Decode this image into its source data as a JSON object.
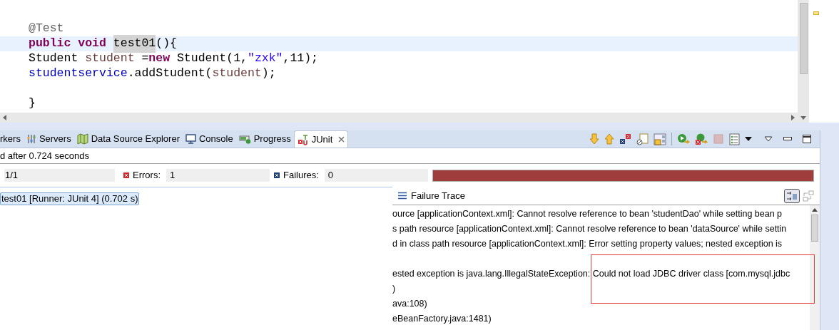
{
  "editor": {
    "lines": [
      {
        "kind": "code",
        "current": false,
        "tokens": [
          {
            "text": "@Test",
            "kind": "annotation"
          }
        ]
      },
      {
        "kind": "code",
        "current": true,
        "tokens": [
          {
            "text": "public ",
            "kind": "keyword"
          },
          {
            "text": "void ",
            "kind": "keyword"
          },
          {
            "text": "test01",
            "kind": "occurrence"
          },
          {
            "text": "(){",
            "kind": "plain"
          }
        ]
      },
      {
        "kind": "code",
        "current": false,
        "tokens": [
          {
            "text": "Student ",
            "kind": "plain"
          },
          {
            "text": "student",
            "kind": "local"
          },
          {
            "text": " =",
            "kind": "plain"
          },
          {
            "text": "new",
            "kind": "keyword"
          },
          {
            "text": " Student(1,",
            "kind": "plain"
          },
          {
            "text": "\"zxk\"",
            "kind": "string"
          },
          {
            "text": ",11);",
            "kind": "plain"
          }
        ]
      },
      {
        "kind": "code",
        "current": false,
        "tokens": [
          {
            "text": "studentservice",
            "kind": "field"
          },
          {
            "text": ".addStudent(",
            "kind": "plain"
          },
          {
            "text": "student",
            "kind": "local"
          },
          {
            "text": ");",
            "kind": "plain"
          }
        ]
      },
      {
        "kind": "blank",
        "current": false
      },
      {
        "kind": "code",
        "current": false,
        "tokens": [
          {
            "text": "}",
            "kind": "plain"
          }
        ]
      }
    ]
  },
  "tabs": [
    {
      "label": "rkers",
      "kind": "markers",
      "selected": false
    },
    {
      "label": "Servers",
      "kind": "servers",
      "selected": false
    },
    {
      "label": "Data Source Explorer",
      "kind": "datasource",
      "selected": false
    },
    {
      "label": "Console",
      "kind": "console",
      "selected": false
    },
    {
      "label": "Progress",
      "kind": "progress",
      "selected": false
    },
    {
      "label": "JUnit",
      "kind": "junit",
      "selected": true
    }
  ],
  "status": "d after 0.724 seconds",
  "counters": {
    "runs": "1/1",
    "errors_label": "Errors:",
    "errors": "1",
    "failures_label": "Failures:",
    "failures": "0"
  },
  "progress": {
    "level": 1,
    "failed": true
  },
  "tests": [
    {
      "label": "test01 [Runner: JUnit 4] (0.702 s)",
      "selected": true
    }
  ],
  "failure_trace": {
    "title": "Failure Trace",
    "blocks": [
      [
        "ource [applicationContext.xml]: Cannot resolve reference to bean 'studentDao' while setting bean p",
        "s path resource [applicationContext.xml]: Cannot resolve reference to bean 'dataSource' while settin",
        "d in class path resource [applicationContext.xml]: Error setting property values; nested exception is"
      ],
      [
        "ested exception is java.lang.IllegalStateException: Could not load JDBC driver class [com.mysql.jdbc",
        ")",
        "ava:108)",
        "eBeanFactory.java:1481)"
      ]
    ]
  }
}
